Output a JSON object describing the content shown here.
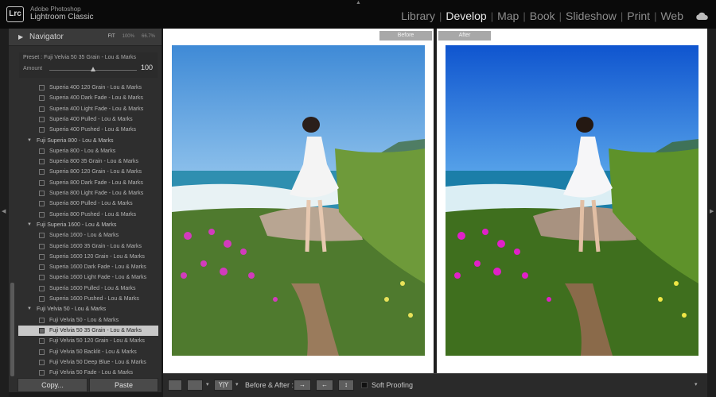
{
  "app": {
    "logo": "Lrc",
    "vendor": "Adobe Photoshop",
    "name": "Lightroom Classic"
  },
  "modules": [
    {
      "label": "Library",
      "active": false
    },
    {
      "label": "Develop",
      "active": true
    },
    {
      "label": "Map",
      "active": false
    },
    {
      "label": "Book",
      "active": false
    },
    {
      "label": "Slideshow",
      "active": false
    },
    {
      "label": "Print",
      "active": false
    },
    {
      "label": "Web",
      "active": false
    }
  ],
  "navigator": {
    "title": "Navigator",
    "zoom_options": [
      "FIT",
      "100%",
      "66.7%"
    ]
  },
  "preset_amount": {
    "preset_text": "Preset : Fuji Velvia 50 35 Grain - Lou & Marks",
    "amount_label": "Amount",
    "amount_value": "100",
    "slider_fraction": 0.5
  },
  "presets": [
    {
      "type": "item",
      "label": "Superia 400 120 Grain - Lou & Marks",
      "selected": false
    },
    {
      "type": "item",
      "label": "Superia 400 Dark Fade - Lou & Marks",
      "selected": false
    },
    {
      "type": "item",
      "label": "Superia 400 Light Fade - Lou & Marks",
      "selected": false
    },
    {
      "type": "item",
      "label": "Superia 400 Pulled - Lou & Marks",
      "selected": false
    },
    {
      "type": "item",
      "label": "Superia 400 Pushed - Lou & Marks",
      "selected": false
    },
    {
      "type": "folder",
      "label": "Fuji Superia 800 - Lou & Marks"
    },
    {
      "type": "item",
      "label": "Superia 800 - Lou & Marks",
      "selected": false
    },
    {
      "type": "item",
      "label": "Superia 800 35 Grain - Lou & Marks",
      "selected": false
    },
    {
      "type": "item",
      "label": "Superia 800 120 Grain - Lou & Marks",
      "selected": false
    },
    {
      "type": "item",
      "label": "Superia 800 Dark Fade - Lou & Marks",
      "selected": false
    },
    {
      "type": "item",
      "label": "Superia 800 Light Fade - Lou & Marks",
      "selected": false
    },
    {
      "type": "item",
      "label": "Superia 800 Pulled - Lou & Marks",
      "selected": false
    },
    {
      "type": "item",
      "label": "Superia 800 Pushed - Lou & Marks",
      "selected": false
    },
    {
      "type": "folder",
      "label": "Fuji Superia 1600 - Lou & Marks"
    },
    {
      "type": "item",
      "label": "Superia 1600 - Lou & Marks",
      "selected": false
    },
    {
      "type": "item",
      "label": "Superia 1600 35 Grain - Lou & Marks",
      "selected": false
    },
    {
      "type": "item",
      "label": "Superia 1600 120 Grain - Lou & Marks",
      "selected": false
    },
    {
      "type": "item",
      "label": "Superia 1600 Dark Fade - Lou & Marks",
      "selected": false
    },
    {
      "type": "item",
      "label": "Superia 1600 Light Fade - Lou & Marks",
      "selected": false
    },
    {
      "type": "item",
      "label": "Superia 1600 Pulled - Lou & Marks",
      "selected": false
    },
    {
      "type": "item",
      "label": "Superia 1600 Pushed - Lou & Marks",
      "selected": false
    },
    {
      "type": "folder",
      "label": "Fuji Velvia 50 - Lou & Marks"
    },
    {
      "type": "item",
      "label": "Fuji Velvia 50 - Lou & Marks",
      "selected": false
    },
    {
      "type": "item",
      "label": "Fuji Velvia 50 35 Grain - Lou & Marks",
      "selected": true
    },
    {
      "type": "item",
      "label": "Fuji Velvia 50 120 Grain - Lou & Marks",
      "selected": false
    },
    {
      "type": "item",
      "label": "Fuji Velvia 50 Backlit - Lou & Marks",
      "selected": false
    },
    {
      "type": "item",
      "label": "Fuji Velvia 50 Deep Blue - Lou & Marks",
      "selected": false
    },
    {
      "type": "item",
      "label": "Fuji Velvia 50 Fade - Lou & Marks",
      "selected": false
    }
  ],
  "buttons": {
    "copy": "Copy...",
    "paste": "Paste"
  },
  "compare": {
    "before_label": "Before",
    "after_label": "After"
  },
  "toolbar": {
    "yy_label": "Y|Y",
    "before_after_label": "Before & After :",
    "soft_proofing_label": "Soft Proofing"
  },
  "colors": {
    "before_sky": "#4f95d8",
    "after_sky": "#1a63d6",
    "selected_row": "#c8c8c8"
  },
  "icons": [
    "cloud-sync-icon",
    "triangle-collapse-icon",
    "panel-arrow-icon"
  ]
}
